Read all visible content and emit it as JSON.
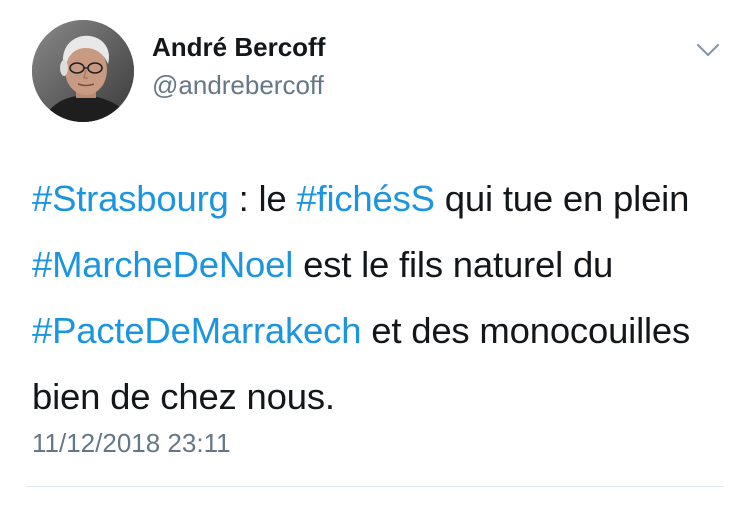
{
  "author": {
    "display_name": "André Bercoff",
    "username": "@andrebercoff",
    "avatar": "profile-photo"
  },
  "tweet": {
    "segments": [
      {
        "text": "#Strasbourg",
        "hashtag": true
      },
      {
        "text": " : le ",
        "hashtag": false
      },
      {
        "text": "#fichésS",
        "hashtag": true
      },
      {
        "text": " qui tue en plein ",
        "hashtag": false
      },
      {
        "text": "#MarcheDeNoel",
        "hashtag": true
      },
      {
        "text": " est le fils naturel du ",
        "hashtag": false
      },
      {
        "text": "#PacteDeMarrakech",
        "hashtag": true
      },
      {
        "text": " et des monocouilles bien de chez nous.",
        "hashtag": false
      }
    ],
    "timestamp": "11/12/2018 23:11"
  },
  "icons": {
    "more": "chevron-down-icon"
  },
  "colors": {
    "hashtag": "#1b95e0",
    "text": "#14171a",
    "secondary": "#657786",
    "divider": "#e1e8ed"
  }
}
